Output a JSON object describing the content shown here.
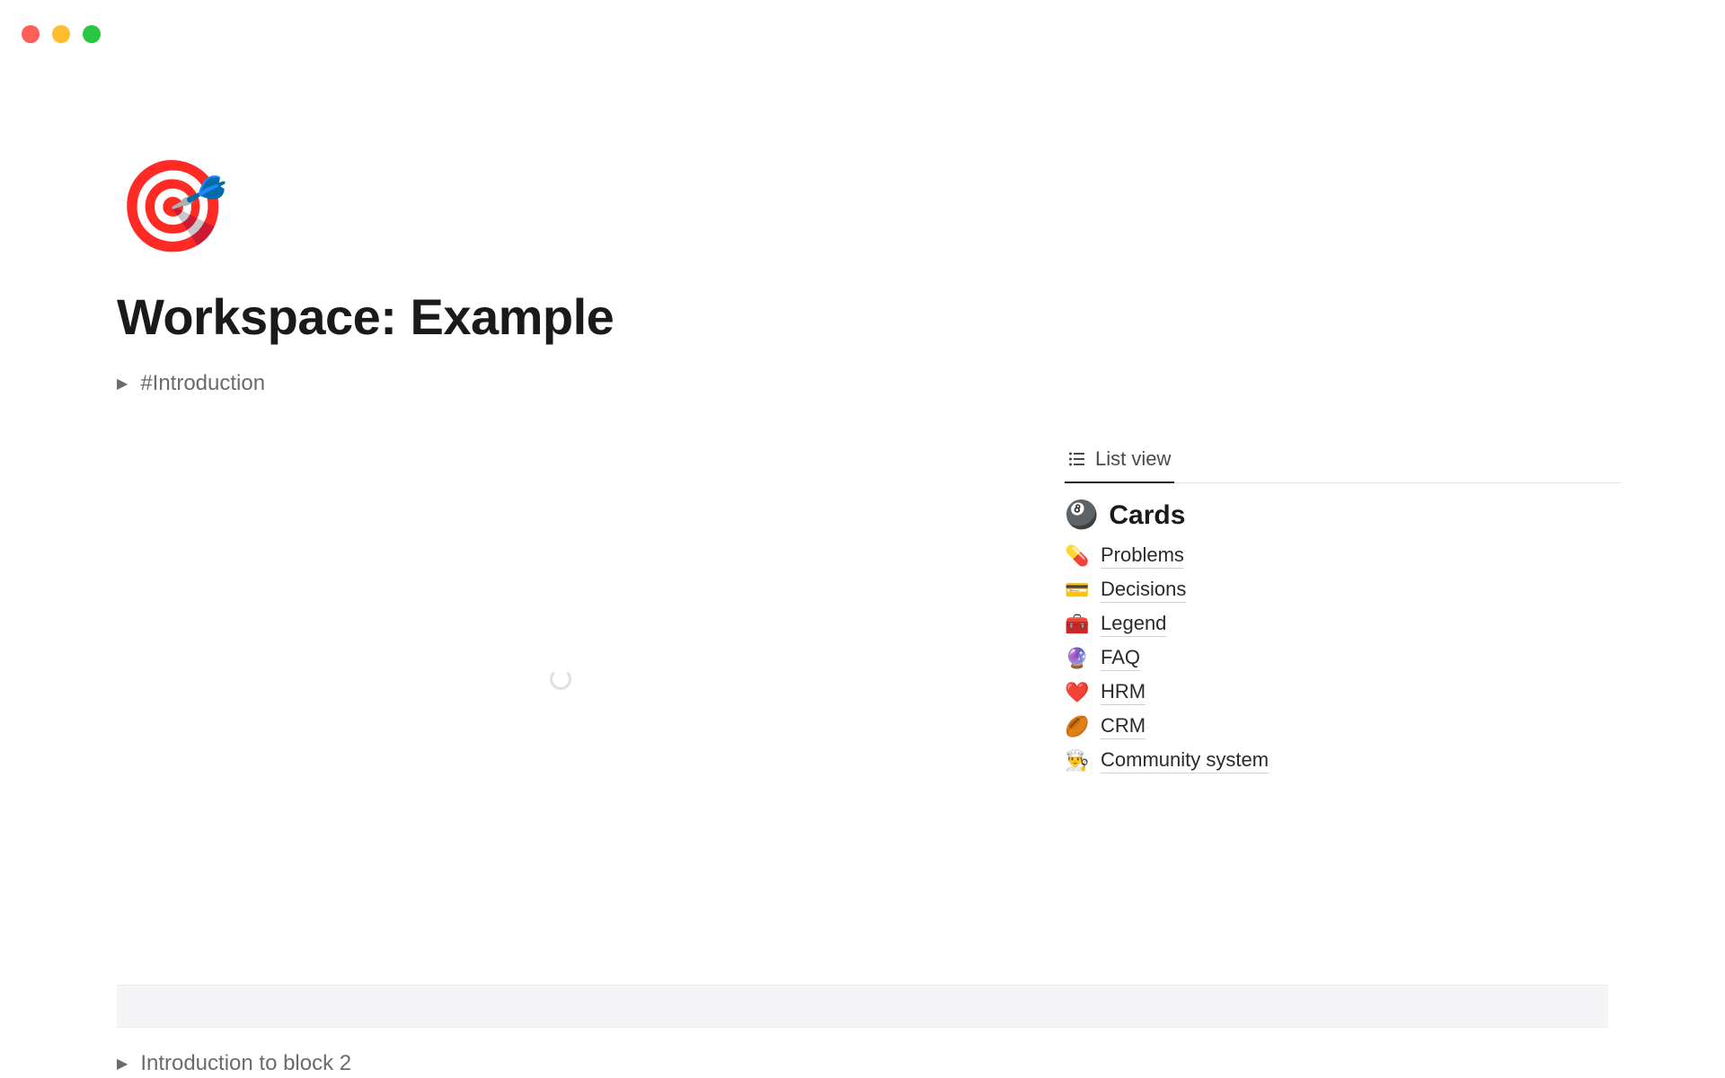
{
  "page": {
    "icon": "🎯",
    "title": "Workspace: Example"
  },
  "toggles": {
    "intro": "#Introduction",
    "block2": "Introduction to block 2"
  },
  "database": {
    "view_tab": "List view",
    "title_icon": "🎱",
    "title": "Cards",
    "items": [
      {
        "icon": "💊",
        "label": "Problems"
      },
      {
        "icon": "💳",
        "label": "Decisions"
      },
      {
        "icon": "🧰",
        "label": "Legend"
      },
      {
        "icon": "🔮",
        "label": "FAQ"
      },
      {
        "icon": "❤️",
        "label": "HRM"
      },
      {
        "icon": "🏉",
        "label": "CRM"
      },
      {
        "icon": "👨‍🍳",
        "label": "Community system"
      }
    ]
  }
}
